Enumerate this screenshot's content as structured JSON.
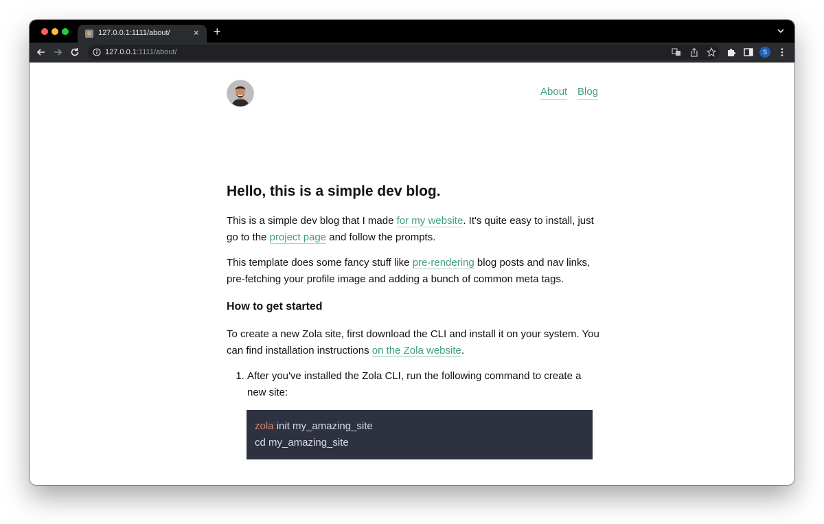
{
  "browser": {
    "tab_title": "127.0.0.1:1111/about/",
    "tab_close": "×",
    "new_tab": "+",
    "url_host": "127.0.0.1",
    "url_rest": ":1111/about/",
    "profile_initial": "S",
    "colors": {
      "frame": "#000000",
      "toolbar": "#2b2c30",
      "omnibox": "#202124",
      "profile": "#1f5fb5"
    }
  },
  "site": {
    "nav": [
      {
        "label": "About"
      },
      {
        "label": "Blog"
      }
    ],
    "link_color": "#3f9d82"
  },
  "article": {
    "heading": "Hello, this is a simple dev blog.",
    "p1_a": "This is a simple dev blog that I made ",
    "p1_link1": "for my website",
    "p1_b": ". It's quite easy to install, just go to the ",
    "p1_link2": "project page",
    "p1_c": " and follow the prompts.",
    "p2_a": "This template does some fancy stuff like ",
    "p2_link": "pre-rendering",
    "p2_b": " blog posts and nav links, pre-fetching your profile image and adding a bunch of common meta tags.",
    "subheading": "How to get started",
    "p3_a": "To create a new Zola site, first download the CLI and install it on your system. You can find installation instructions ",
    "p3_link": "on the Zola website",
    "p3_b": ".",
    "step1": "After you've installed the Zola CLI, run the following command to create a new site:",
    "code_line1_cmd": "zola",
    "code_line1_rest": " init my_amazing_site",
    "code_line2": "cd my_amazing_site"
  }
}
